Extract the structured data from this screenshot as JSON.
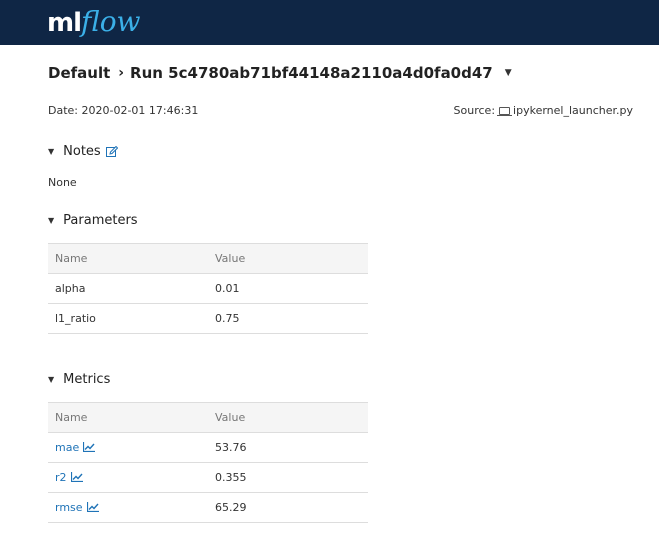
{
  "app": {
    "logo_ml": "ml",
    "logo_flow": "flow"
  },
  "breadcrumb": {
    "experiment": "Default",
    "separator": "›",
    "run": "Run 5c4780ab71bf44148a2110a4d0fa0d47"
  },
  "run_info": {
    "date_label": "Date:",
    "date_value": "2020-02-01 17:46:31",
    "source_label": "Source:",
    "source_value": "ipykernel_launcher.py"
  },
  "notes": {
    "title": "Notes",
    "content": "None"
  },
  "parameters": {
    "title": "Parameters",
    "columns": [
      "Name",
      "Value"
    ],
    "rows": [
      {
        "name": "alpha",
        "value": "0.01"
      },
      {
        "name": "l1_ratio",
        "value": "0.75"
      }
    ]
  },
  "metrics": {
    "title": "Metrics",
    "columns": [
      "Name",
      "Value"
    ],
    "rows": [
      {
        "name": "mae",
        "value": "53.76"
      },
      {
        "name": "r2",
        "value": "0.355"
      },
      {
        "name": "rmse",
        "value": "65.29"
      }
    ]
  },
  "colors": {
    "header_bg": "#0f2645",
    "logo_accent": "#3bb0e8",
    "link": "#1f73b7"
  },
  "icons": {
    "edit": "edit-icon",
    "chart": "line-chart-icon",
    "source": "laptop-icon"
  }
}
